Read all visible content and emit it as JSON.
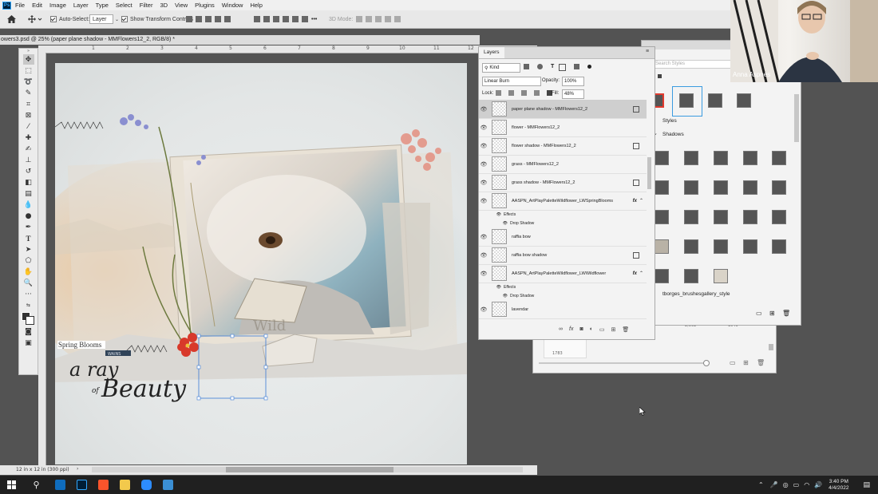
{
  "app": {
    "name": "Ps"
  },
  "menu": [
    "File",
    "Edit",
    "Image",
    "Layer",
    "Type",
    "Select",
    "Filter",
    "3D",
    "View",
    "Plugins",
    "Window",
    "Help"
  ],
  "options": {
    "auto_select": "Auto-Select:",
    "layer_select": "Layer",
    "show_transform": "Show Transform Controls",
    "mode_3d": "3D Mode:"
  },
  "document": {
    "tab_title": "owers3.psd @ 25% (paper plane shadow - MMFlowers12_2, RGB/8) *",
    "ruler_marks": [
      "1",
      "2",
      "3",
      "4",
      "5",
      "6",
      "7",
      "8",
      "9",
      "10",
      "11",
      "12"
    ],
    "status": "12 in x 12 in (300 ppi)"
  },
  "artwork": {
    "title_line1": "Spring Blooms",
    "title_ray": "a ray",
    "title_of": "of",
    "title_beauty": "Beauty",
    "tag_text": "Wild",
    "ribbon_text": "WAINS"
  },
  "layers_panel": {
    "tab": "Layers",
    "filter_kind": "Kind",
    "blend_mode": "Linear Burn",
    "opacity_label": "Opacity:",
    "opacity_value": "100%",
    "lock_label": "Lock:",
    "fill_label": "Fill:",
    "fill_value": "48%",
    "layers": [
      {
        "name": "paper plane shadow - MMFlowers12_2",
        "selected": true,
        "badge": true,
        "fx": false
      },
      {
        "name": "flower - MMFlowers12_2",
        "selected": false,
        "badge": false,
        "fx": false
      },
      {
        "name": "flower shadow - MMFlowers12_2",
        "selected": false,
        "badge": true,
        "fx": false
      },
      {
        "name": "grass - MMFlowers12_2",
        "selected": false,
        "badge": false,
        "fx": false
      },
      {
        "name": "grass shadow - MMFlowers12_2",
        "selected": false,
        "badge": true,
        "fx": false
      },
      {
        "name": "AASPN_ArtPlayPaletteWildflower_LWSpringBlooms",
        "selected": false,
        "badge": false,
        "fx": true
      },
      {
        "name": "raffia bow",
        "selected": false,
        "badge": false,
        "fx": false
      },
      {
        "name": "raffia bow shadow",
        "selected": false,
        "badge": true,
        "fx": false
      },
      {
        "name": "AASPN_ArtPlayPaletteWildflower_LWWildflower",
        "selected": false,
        "badge": false,
        "fx": true
      },
      {
        "name": "lavendar",
        "selected": false,
        "badge": false,
        "fx": false
      }
    ],
    "effects_label": "Effects",
    "drop_shadow_label": "Drop Shadow",
    "fx_glyph": "fx"
  },
  "styles_panel": {
    "search_placeholder": "Search Styles",
    "group_styles": "Styles",
    "group_shadows": "Shadows",
    "group_brushes": "tborges_brushesgallery_style"
  },
  "brushes_panel": {
    "values": [
      "2,992",
      "1049",
      "1783"
    ]
  },
  "webcam": {
    "name": "Anna Aspnes"
  },
  "taskbar": {
    "time": "3:40 PM",
    "date": "4/4/2022"
  },
  "colors": {
    "ps_blue": "#31a8ff",
    "taskbar": "#202020",
    "selected_style": "#3a9be0",
    "red_style": "#e03a2e"
  }
}
